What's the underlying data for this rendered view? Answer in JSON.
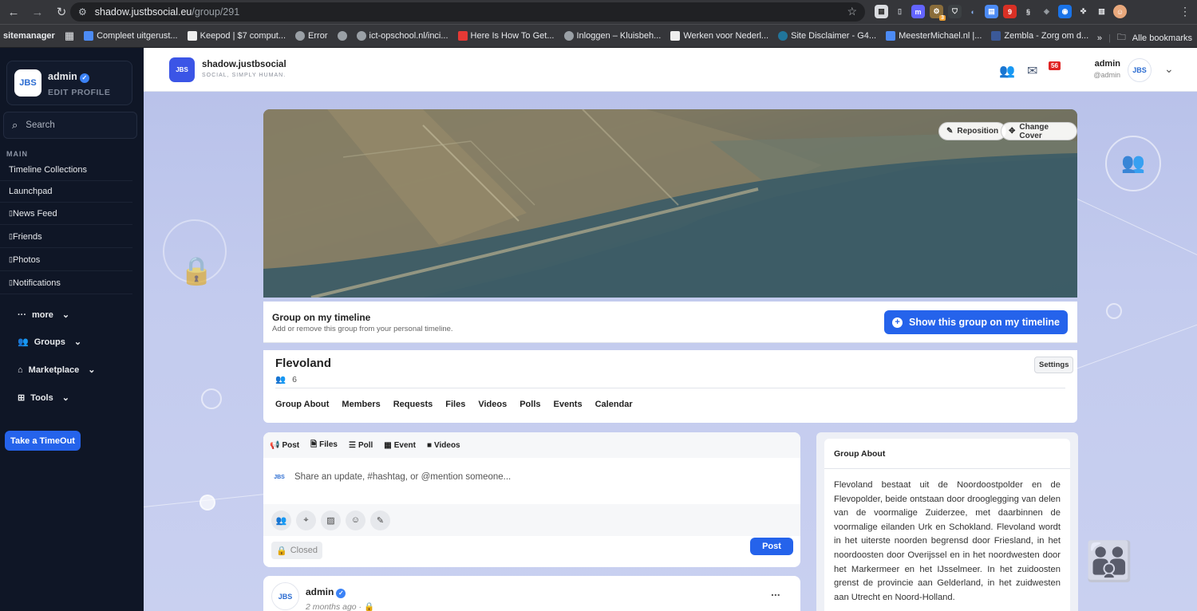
{
  "browser": {
    "url_host": "shadow.justbsocial.eu",
    "url_path": "/group/291",
    "extension_badge": "3",
    "bookmarks": [
      {
        "label": "sitemanager",
        "color": ""
      },
      {
        "label": "Compleet uitgerust...",
        "color": "#4c8bf5"
      },
      {
        "label": "Keepod | $7 comput...",
        "color": "#222222"
      },
      {
        "label": "Error",
        "color": "#9aa0a6"
      },
      {
        "label": "",
        "color": "#9aa0a6"
      },
      {
        "label": "ict-opschool.nl/inci...",
        "color": "#9aa0a6"
      },
      {
        "label": "Here Is How To Get...",
        "color": "#e53935"
      },
      {
        "label": "Inloggen – Kluisbeh...",
        "color": "#9aa0a6"
      },
      {
        "label": "Werken voor Nederl...",
        "color": "#1a3c8f"
      },
      {
        "label": "Site Disclaimer - G4...",
        "color": "#21759b"
      },
      {
        "label": "MeesterMichael.nl |...",
        "color": "#4c8bf5"
      },
      {
        "label": "Zembla - Zorg om d...",
        "color": "#3b5998"
      }
    ],
    "all_bookmarks": "Alle bookmarks"
  },
  "sidebar": {
    "user_name": "admin",
    "edit_profile": "EDIT PROFILE",
    "search_placeholder": "Search",
    "section_label": "MAIN",
    "items": [
      {
        "label": "Timeline Collections"
      },
      {
        "label": "Launchpad"
      },
      {
        "label": "News Feed"
      },
      {
        "label": "Friends"
      },
      {
        "label": "Photos"
      },
      {
        "label": "Notifications"
      }
    ],
    "sub": [
      {
        "label": "more"
      },
      {
        "label": "Groups"
      },
      {
        "label": "Marketplace"
      },
      {
        "label": "Tools"
      }
    ],
    "timeout_button": "Take a TimeOut"
  },
  "header": {
    "logo_text": "JBS",
    "brand_name": "shadow.justbsocial",
    "brand_tagline": "SOCIAL, SIMPLY HUMAN.",
    "message_count": "56",
    "user_name": "admin",
    "user_handle": "@admin"
  },
  "cover": {
    "reposition": "Reposition",
    "change_cover": "Change Cover"
  },
  "timeline_toggle": {
    "title": "Group on my timeline",
    "subtitle": "Add or remove this group from your personal timeline.",
    "button": "Show this group on my timeline"
  },
  "group": {
    "name": "Flevoland",
    "member_count": "6",
    "settings": "Settings",
    "tabs": [
      "Group About",
      "Members",
      "Requests",
      "Files",
      "Videos",
      "Polls",
      "Events",
      "Calendar"
    ]
  },
  "composer": {
    "tabs": [
      "Post",
      "Files",
      "Poll",
      "Event",
      "Videos"
    ],
    "placeholder": "Share an update, #hashtag, or @mention someone...",
    "privacy": "Closed",
    "post_button": "Post"
  },
  "post": {
    "author": "admin",
    "time": "2 months ago",
    "more": "..."
  },
  "about": {
    "title": "Group About",
    "text": "Flevoland bestaat uit de Noordoostpolder en de Flevopolder, beide ontstaan door drooglegging van delen van de voormalige Zuiderzee, met daarbinnen de voormalige eilanden Urk en Schokland. Flevoland wordt in het uiterste noorden begrensd door Friesland, in het noordoosten door Overijssel en in het noordwesten door het Markermeer en het IJsselmeer. In het zuidoosten grenst de provincie aan Gelderland, in het zuidwesten aan Utrecht en Noord-Holland."
  }
}
